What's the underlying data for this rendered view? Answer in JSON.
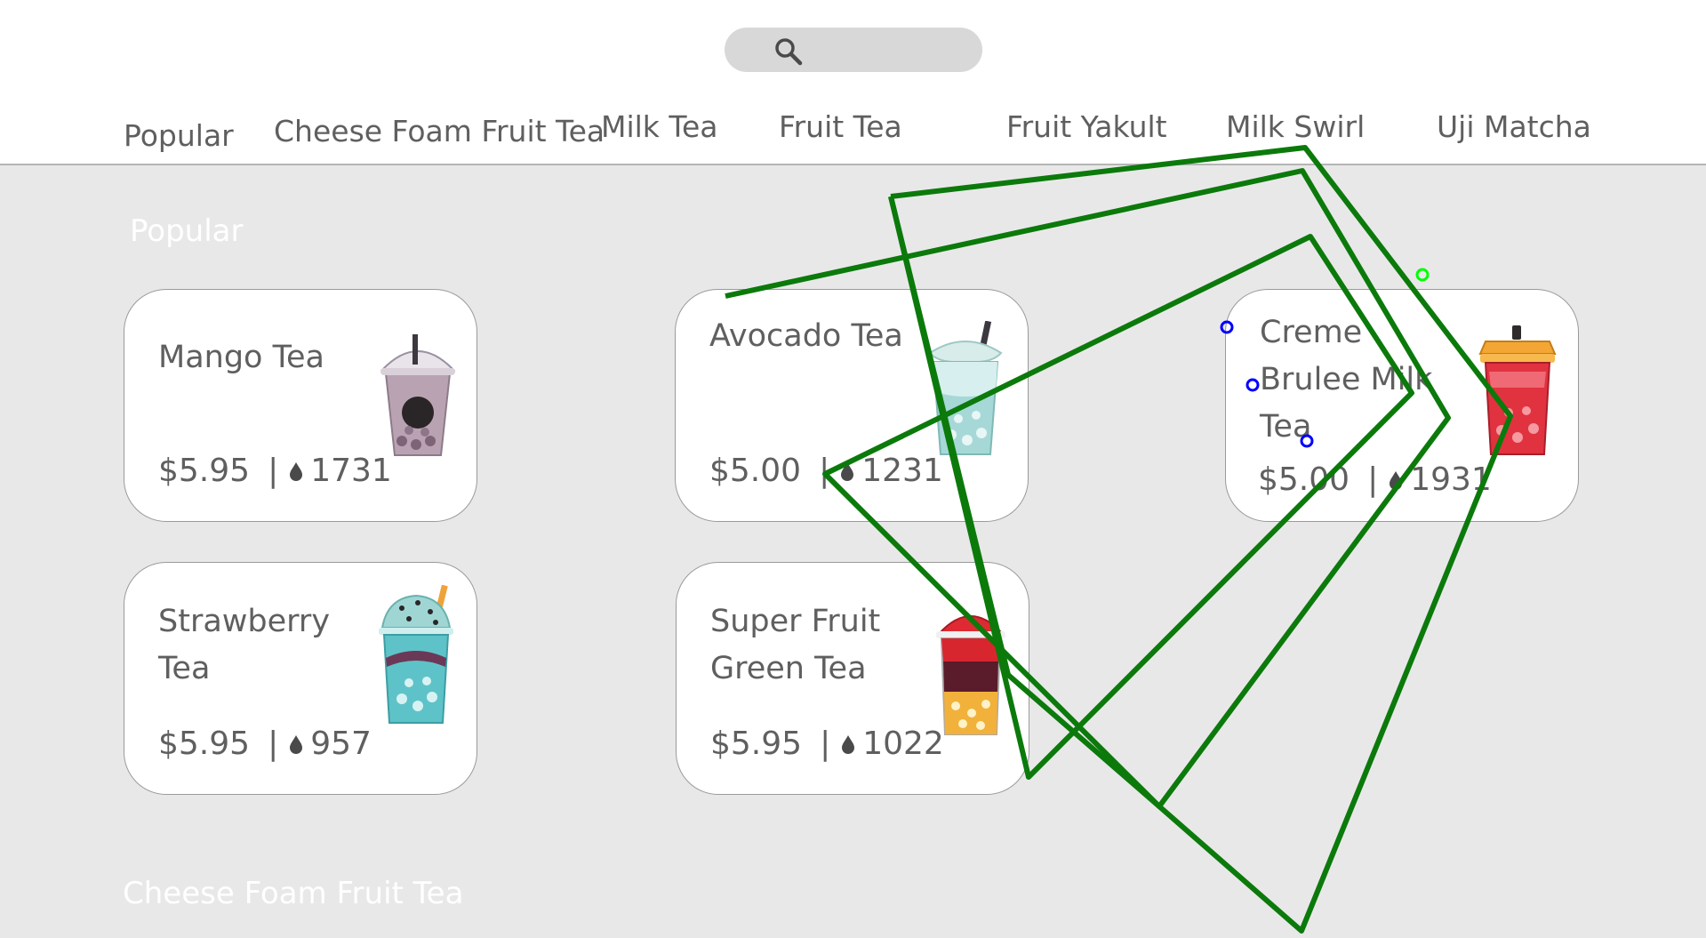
{
  "search": {
    "icon": "search-icon",
    "placeholder": ""
  },
  "categories": [
    "Popular",
    "Cheese Foam Fruit Tea",
    "Milk Tea",
    "Fruit Tea",
    "Fruit Yakult",
    "Milk Swirl",
    "Uji Matcha"
  ],
  "sections": {
    "popular_title": "Popular",
    "cheese_title": "Cheese Foam Fruit Tea"
  },
  "products": [
    {
      "name": "Mango Tea",
      "price": "$5.95",
      "likes": "1731",
      "icon": "mango-tea-cup-icon"
    },
    {
      "name": "Avocado Tea",
      "price": "$5.00",
      "likes": "1231",
      "icon": "avocado-tea-cup-icon"
    },
    {
      "name": "Creme Brulee Milk Tea",
      "price": "$5.00",
      "likes": "1931",
      "icon": "creme-brulee-cup-icon"
    },
    {
      "name": "Strawberry Tea",
      "price": "$5.95",
      "likes": "957",
      "icon": "strawberry-tea-cup-icon"
    },
    {
      "name": "Super Fruit Green Tea",
      "price": "$5.95",
      "likes": "1022",
      "icon": "super-fruit-cup-icon"
    }
  ],
  "separator": "|",
  "colors": {
    "background": "#e9e8e9",
    "card": "#ffffff",
    "text": "#5f5f5f",
    "annotation_stroke": "#0b7a0b",
    "annotation_point_blue": "#0000ff",
    "annotation_point_green": "#00ff00"
  }
}
